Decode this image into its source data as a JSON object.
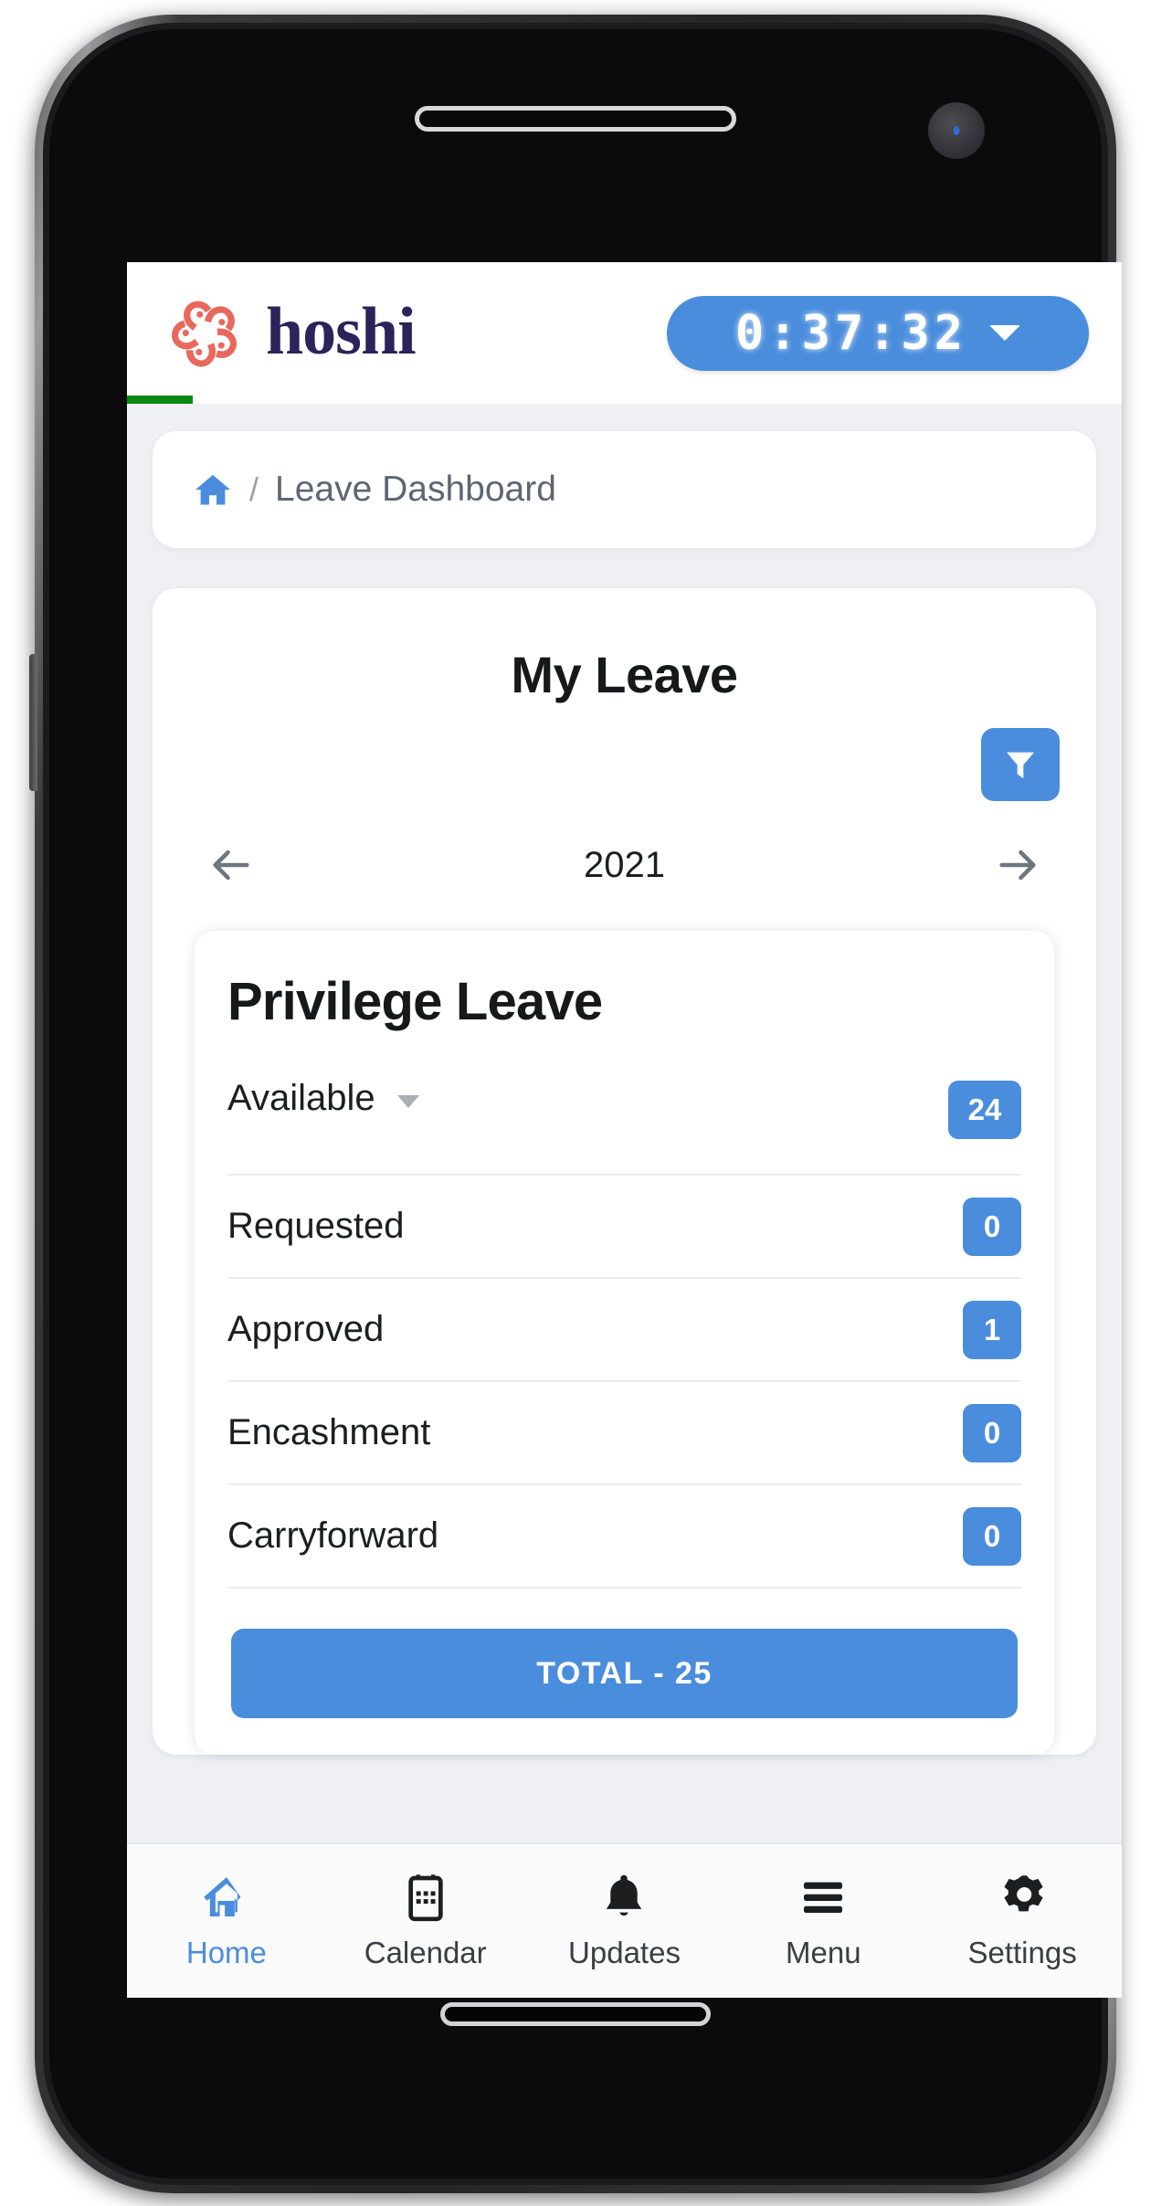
{
  "device": {
    "earpiece": "earpiece-speaker",
    "camera": "front-camera",
    "home_indicator": "home-indicator"
  },
  "header": {
    "brand_name": "hoshi",
    "brand_mark_icon": "hoshi-star-logo",
    "timer_value": "0:37:32",
    "timer_caret_icon": "chevron-down-icon",
    "loading_bar_color": "#0a8a12",
    "accent_color": "#4a8ddd",
    "brand_word_color": "#2b2359",
    "brand_mark_color": "#e8695c"
  },
  "breadcrumb": {
    "home_icon": "home-icon",
    "separator": "/",
    "current": "Leave Dashboard"
  },
  "leave_card": {
    "title": "My Leave",
    "filter_icon": "funnel-icon",
    "prev_icon": "arrow-left-icon",
    "next_icon": "arrow-right-icon",
    "year": "2021"
  },
  "leave_type": {
    "name": "Privilege Leave",
    "rows": [
      {
        "label": "Available",
        "value": "24",
        "has_dropdown": true
      },
      {
        "label": "Requested",
        "value": "0",
        "has_dropdown": false
      },
      {
        "label": "Approved",
        "value": "1",
        "has_dropdown": false
      },
      {
        "label": "Encashment",
        "value": "0",
        "has_dropdown": false
      },
      {
        "label": "Carryforward",
        "value": "0",
        "has_dropdown": false
      }
    ],
    "total_label": "TOTAL - 25"
  },
  "bottom_nav": {
    "items": [
      {
        "label": "Home",
        "icon": "home-icon",
        "active": true
      },
      {
        "label": "Calendar",
        "icon": "calendar-icon",
        "active": false
      },
      {
        "label": "Updates",
        "icon": "bell-icon",
        "active": false
      },
      {
        "label": "Menu",
        "icon": "hamburger-icon",
        "active": false
      },
      {
        "label": "Settings",
        "icon": "gear-icon",
        "active": false
      }
    ]
  }
}
